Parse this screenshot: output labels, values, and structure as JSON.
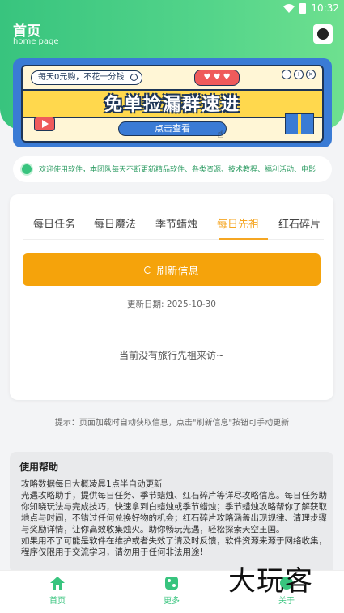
{
  "status_bar": {
    "time": "10:32"
  },
  "header": {
    "title": "首页",
    "subtitle": "home page"
  },
  "banner": {
    "search_pill": "每天0元购，不花一分钱",
    "bubble": "♥ ♥ ♥",
    "controls": [
      "−",
      "+",
      "×"
    ],
    "headline": "免单捡漏群速进",
    "cta": "点击查看"
  },
  "notice": {
    "text": "欢迎使用软件，本团队每天不断更新精品软件、各类资源、技术教程、福利活动、电影"
  },
  "tabs": [
    {
      "label": "每日任务"
    },
    {
      "label": "每日魔法"
    },
    {
      "label": "季节蜡烛"
    },
    {
      "label": "每日先祖"
    },
    {
      "label": "红石碎片"
    }
  ],
  "main": {
    "refresh_label": "刷新信息",
    "update_date": "更新日期: 2025-10-30",
    "empty_message": "当前没有旅行先祖来访~"
  },
  "tip": "提示：页面加载时自动获取信息，点击\"刷新信息\"按钮可手动更新",
  "help": {
    "title": "使用帮助",
    "lines": [
      "攻略数据每日大概凌晨1点半自动更新",
      "光遇攻略助手，提供每日任务、季节蜡烛、红石碎片等详尽攻略信息。每日任务助你知晓玩法与完成技巧，快速拿到白蜡烛或季节蜡烛；季节蜡烛攻略帮你了解获取地点与时间，不错过任何兑换好物的机会；红石碎片攻略涵盖出现规律、清理步骤与奖励详情，让你高效收集烛火。助你畅玩光遇，轻松探索天空王国。",
      "如果用不了可能是软件在维护或者失效了请及时反馈，软件资源来源于网络收集，程序仅限用于交流学习，请勿用于任何非法用途!"
    ]
  },
  "bottom_nav": [
    {
      "label": "首页",
      "icon": "home-icon"
    },
    {
      "label": "更多",
      "icon": "apps-icon"
    },
    {
      "label": "关于",
      "icon": "info-icon"
    }
  ],
  "watermark": "大玩客",
  "colors": {
    "primary_green": "#38c47e",
    "accent_orange": "#f5a30b"
  }
}
